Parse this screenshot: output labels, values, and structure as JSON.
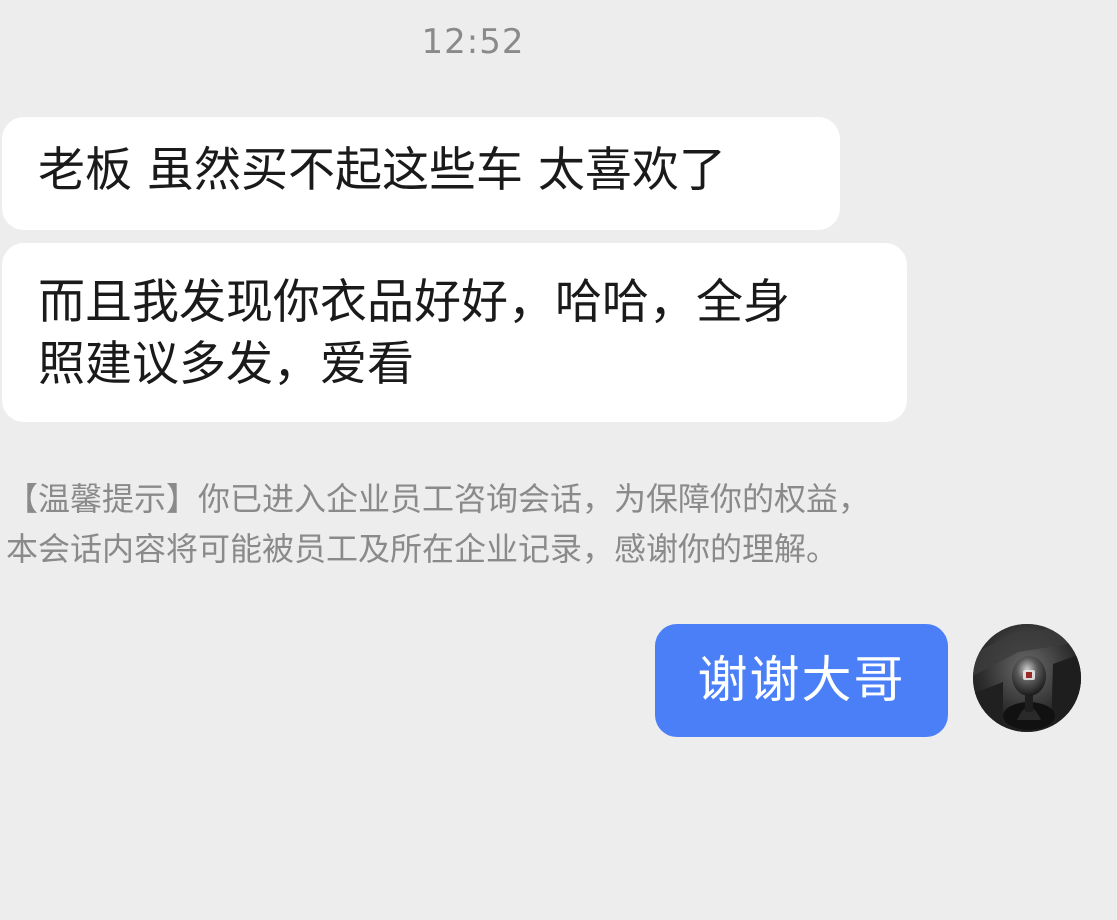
{
  "chat": {
    "timestamp": "12:52",
    "messages": [
      {
        "side": "incoming",
        "text": "老板 虽然买不起这些车 太喜欢了"
      },
      {
        "side": "incoming",
        "line1": "而且我发现你衣品好好，哈哈，全身",
        "line2": "照建议多发，爱看"
      },
      {
        "side": "system",
        "line1": "【温馨提示】你已进入企业员工咨询会话，为保障你的权益，",
        "line2": "本会话内容将可能被员工及所在企业记录，感谢你的理解。"
      },
      {
        "side": "outgoing",
        "text": "谢谢大哥"
      }
    ],
    "avatar_icon": "car-gear-shifter-avatar-icon"
  },
  "colors": {
    "background": "#ededed",
    "incoming_bubble": "#ffffff",
    "outgoing_bubble": "#4a7ff7",
    "notice_text": "#8a8a8a"
  }
}
